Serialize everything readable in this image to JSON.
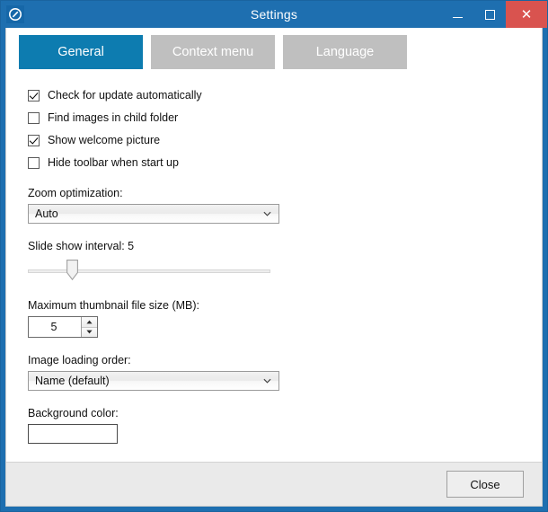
{
  "window": {
    "title": "Settings",
    "icon": "app-logo-icon",
    "accent_titlebar": "#1e6fb0",
    "accent_tab_active": "#0d7cb0",
    "close_button_color": "#d9534f",
    "controls": {
      "minimize": "minimize-icon",
      "maximize": "maximize-icon",
      "close": "✕"
    }
  },
  "tabs": [
    {
      "label": "General",
      "active": true
    },
    {
      "label": "Context menu",
      "active": false
    },
    {
      "label": "Language",
      "active": false
    }
  ],
  "general": {
    "checkboxes": [
      {
        "label": "Check for update automatically",
        "checked": true
      },
      {
        "label": "Find images in child folder",
        "checked": false
      },
      {
        "label": "Show welcome picture",
        "checked": true
      },
      {
        "label": "Hide toolbar when start up",
        "checked": false
      }
    ],
    "zoom_optimization": {
      "label": "Zoom optimization:",
      "value": "Auto"
    },
    "slide_show": {
      "label": "Slide show interval: 5",
      "value": 5,
      "min": 1,
      "max": 30
    },
    "max_thumbnail": {
      "label": "Maximum thumbnail file size (MB):",
      "value": "5"
    },
    "image_loading_order": {
      "label": "Image loading order:",
      "value": "Name (default)"
    },
    "background_color": {
      "label": "Background color:",
      "value": "#ffffff"
    }
  },
  "footer": {
    "close_label": "Close"
  }
}
